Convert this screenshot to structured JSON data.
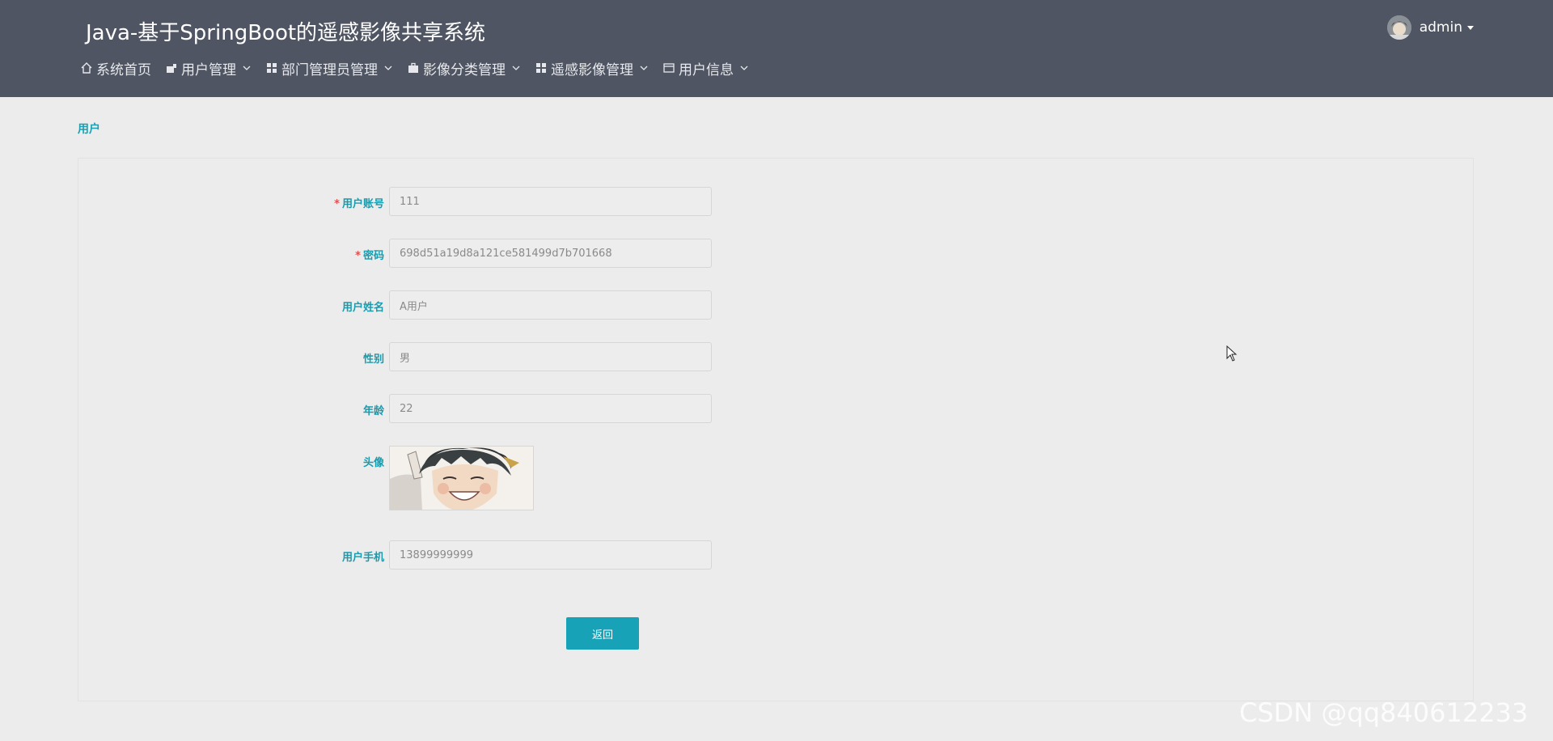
{
  "app": {
    "title": "Java-基于SpringBoot的遥感影像共享系统"
  },
  "nav": {
    "items": [
      {
        "label": "系统首页",
        "icon": "home-icon",
        "dropdown": false
      },
      {
        "label": "用户管理",
        "icon": "user-icon",
        "dropdown": true
      },
      {
        "label": "部门管理员管理",
        "icon": "grid-icon",
        "dropdown": true
      },
      {
        "label": "影像分类管理",
        "icon": "briefcase-icon",
        "dropdown": true
      },
      {
        "label": "遥感影像管理",
        "icon": "grid-icon",
        "dropdown": true
      },
      {
        "label": "用户信息",
        "icon": "card-icon",
        "dropdown": true
      }
    ]
  },
  "user": {
    "name": "admin"
  },
  "breadcrumb": {
    "current": "用户"
  },
  "form": {
    "account": {
      "label": "用户账号",
      "required": true,
      "value": "111"
    },
    "password": {
      "label": "密码",
      "required": true,
      "value": "698d51a19d8a121ce581499d7b701668"
    },
    "name": {
      "label": "用户姓名",
      "required": false,
      "value": "A用户"
    },
    "gender": {
      "label": "性别",
      "required": false,
      "value": "男"
    },
    "age": {
      "label": "年龄",
      "required": false,
      "value": "22"
    },
    "avatar": {
      "label": "头像",
      "required": false
    },
    "phone": {
      "label": "用户手机",
      "required": false,
      "value": "13899999999"
    },
    "back_label": "返回",
    "required_mark": "*"
  },
  "watermark": "CSDN @qq840612233",
  "colors": {
    "header_bg": "#4f5562",
    "accent": "#17a2b8",
    "label": "#1a9bad",
    "required": "#e05151",
    "page_bg": "#ececec"
  }
}
